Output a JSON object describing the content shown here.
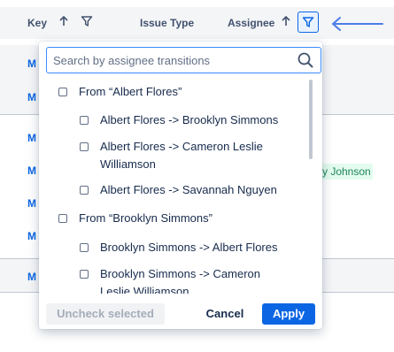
{
  "table": {
    "headers": {
      "key": "Key",
      "issue_type": "Issue Type",
      "assignee": "Assignee"
    },
    "row_keys": [
      "M",
      "M",
      "M",
      "M",
      "M",
      "M",
      "M"
    ],
    "visible_assignee_fragment": "y Johnson"
  },
  "filter_dropdown": {
    "search": {
      "value": "",
      "placeholder": "Search by assignee transitions"
    },
    "groups": [
      {
        "label": "From “Albert Flores”",
        "checked": false,
        "items": [
          {
            "label": "Albert Flores -> Brooklyn Simmons",
            "checked": false
          },
          {
            "label": "Albert Flores -> Cameron Leslie Williamson",
            "checked": false
          },
          {
            "label": "Albert Flores -> Savannah Nguyen",
            "checked": false
          }
        ]
      },
      {
        "label": "From “Brooklyn Simmons”",
        "checked": false,
        "items": [
          {
            "label": "Brooklyn Simmons -> Albert Flores",
            "checked": false
          },
          {
            "label": "Brooklyn Simmons -> Cameron Leslie Williamson",
            "checked": false
          }
        ]
      }
    ],
    "buttons": {
      "uncheck_selected": "Uncheck selected",
      "cancel": "Cancel",
      "apply": "Apply"
    }
  },
  "colors": {
    "primary": "#0c66e4",
    "annotation_arrow": "#4c7ee8",
    "assignee_badge_bg": "#e3fcef",
    "assignee_badge_text": "#1f845a"
  },
  "icons": [
    "arrow-up-icon",
    "filter-icon",
    "search-icon",
    "left-arrow-annotation"
  ]
}
